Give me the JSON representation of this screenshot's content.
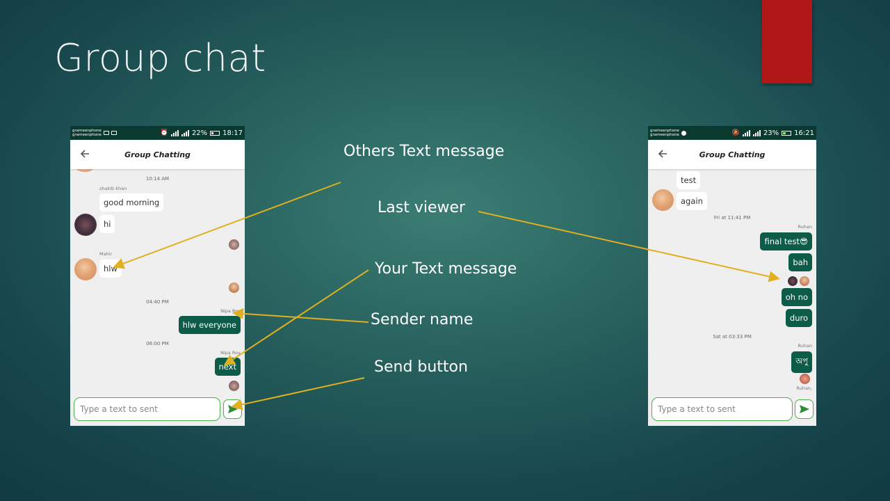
{
  "slide": {
    "title": "Group chat"
  },
  "annotations": {
    "others_text": "Others Text message",
    "last_viewer": "Last viewer",
    "your_text": "Your Text message",
    "sender_name": "Sender name",
    "send_button": "Send button"
  },
  "colors": {
    "accent_green": "#0d5c4a",
    "status_bar": "#0a3a2f",
    "input_border": "#4caf50",
    "arrow": "#e0b020",
    "red_bar": "#b01818"
  },
  "phone_left": {
    "status": {
      "carrier1": "grameenphone",
      "carrier2": "grameenphone",
      "battery": "22%",
      "time": "18:17"
    },
    "appbar": {
      "title": "Group Chatting"
    },
    "chat": {
      "stamp1": "10:14 AM",
      "sender1": "shakib khan",
      "msg1": "good morning",
      "msg2": "hi",
      "sender2": "Mahir",
      "msg3": "hlw",
      "stamp2": "04:40 PM",
      "sender3": "Nipa Roy",
      "msg4": "hlw everyone",
      "stamp3": "06:00 PM",
      "sender4": "Nipa Roy",
      "msg5": "next"
    },
    "input": {
      "placeholder": "Type a text to sent",
      "value": ""
    }
  },
  "phone_right": {
    "status": {
      "carrier1": "grameenphone",
      "carrier2": "grameenphone",
      "battery": "23%",
      "time": "16:21"
    },
    "appbar": {
      "title": "Group Chatting"
    },
    "chat": {
      "msg1": "test",
      "msg2": "again",
      "stamp1": "Fri at 11:41 PM",
      "sender1": "Ruhan",
      "msg3": "final test😎",
      "msg4": "bah",
      "msg5": "oh no",
      "msg6": "duro",
      "stamp2": "Sat at 03:33 PM",
      "sender2": "Ruhan",
      "msg7": "অপু",
      "seen_by": "Ruhan,"
    },
    "input": {
      "placeholder": "Type a text to sent",
      "value": ""
    }
  }
}
